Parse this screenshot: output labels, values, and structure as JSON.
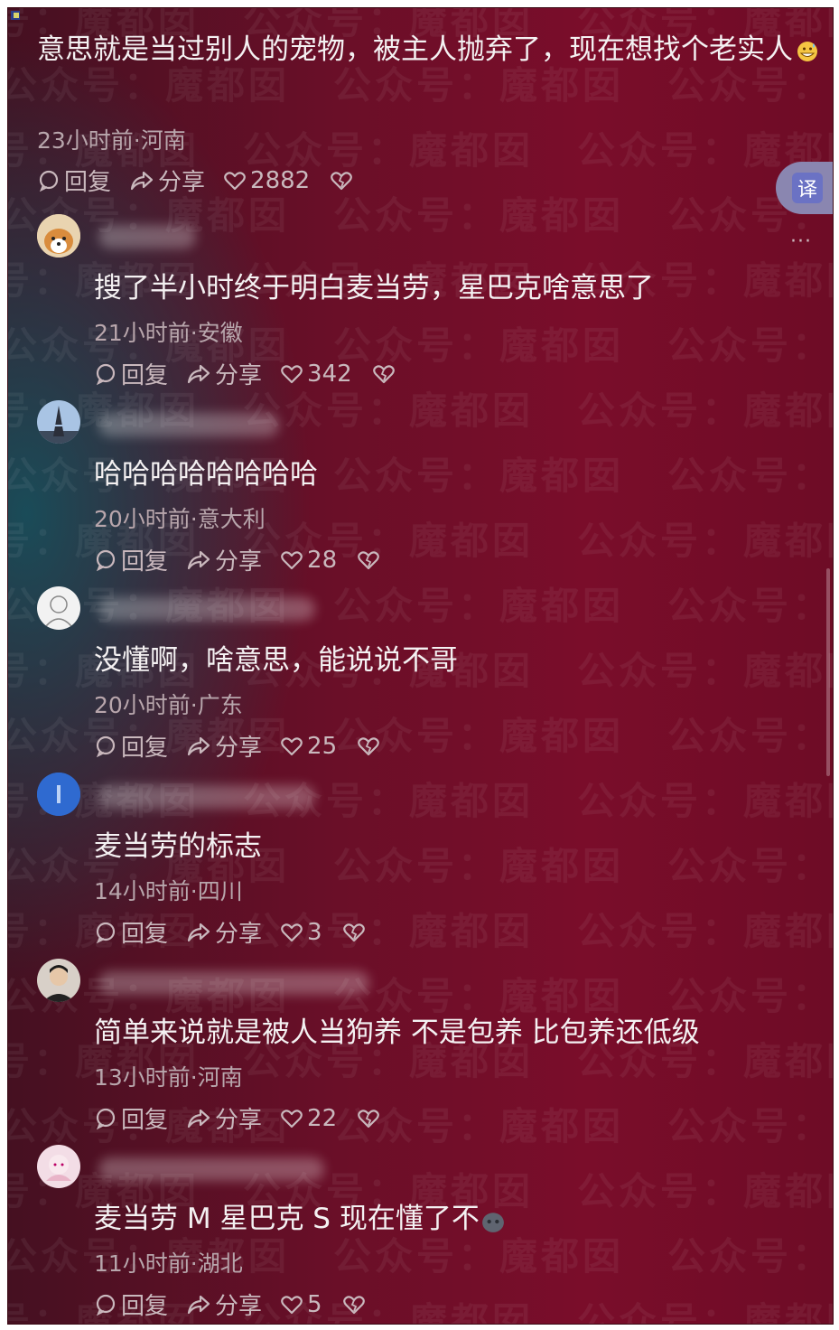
{
  "top_comment": {
    "text": "意思就是当过别人的宠物，被主人抛弃了，现在想找个老实人",
    "emoji": "grinning-sweat-emoji",
    "meta": "23小时前·河南",
    "reply_label": "回复",
    "share_label": "分享",
    "likes": "2882"
  },
  "translate_button": {
    "label": "译"
  },
  "more_menu": {
    "label": "···"
  },
  "watermark": {
    "text": "魔都囡",
    "text2": "公众号："
  },
  "comments": [
    {
      "text": "搜了半小时终于明白麦当劳，星巴克啥意思了",
      "meta": "21小时前·安徽",
      "reply_label": "回复",
      "share_label": "分享",
      "likes": "342",
      "avatar": "shiba-dog-avatar"
    },
    {
      "text": "哈哈哈哈哈哈哈哈",
      "meta": "20小时前·意大利",
      "reply_label": "回复",
      "share_label": "分享",
      "likes": "28",
      "avatar": "eiffel-tower-avatar"
    },
    {
      "text": "没懂啊，啥意思，能说说不哥",
      "meta": "20小时前·广东",
      "reply_label": "回复",
      "share_label": "分享",
      "likes": "25",
      "avatar": "sketch-portrait-avatar"
    },
    {
      "text": "麦当劳的标志",
      "meta": "14小时前·四川",
      "reply_label": "回复",
      "share_label": "分享",
      "likes": "3",
      "avatar": "blue-circle-avatar"
    },
    {
      "text": "简单来说就是被人当狗养 不是包养 比包养还低级",
      "meta": "13小时前·河南",
      "reply_label": "回复",
      "share_label": "分享",
      "likes": "22",
      "avatar": "person-photo-avatar"
    },
    {
      "text": "麦当劳 M 星巴克 S 现在懂了不",
      "meta": "11小时前·湖北",
      "reply_label": "回复",
      "share_label": "分享",
      "likes": "5",
      "avatar": "pink-anime-avatar",
      "emoji": "gray-blob-emoji"
    }
  ]
}
